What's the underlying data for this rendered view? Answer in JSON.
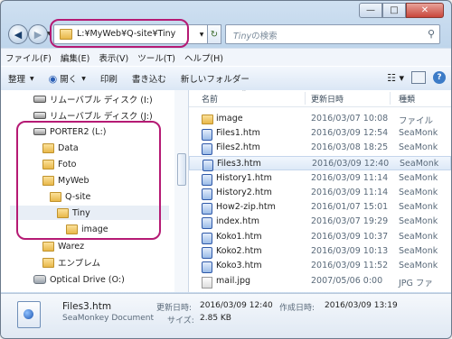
{
  "address": {
    "path": "L:¥MyWeb¥Q-site¥Tiny"
  },
  "search": {
    "prefix": "Tiny",
    "suffix": "の検索"
  },
  "menu": [
    "ファイル(F)",
    "編集(E)",
    "表示(V)",
    "ツール(T)",
    "ヘルプ(H)"
  ],
  "toolbar": {
    "organize": "整理",
    "open": "開く",
    "print": "印刷",
    "burn": "書き込む",
    "new_folder": "新しいフォルダー"
  },
  "tree": [
    {
      "label": "リムーバブル ディスク (I:)",
      "icon": "drive-icon"
    },
    {
      "label": "リムーバブル ディスク (J:)",
      "icon": "drive-icon"
    },
    {
      "label": "PORTER2 (L:)",
      "icon": "drive-icon"
    },
    {
      "label": "Data",
      "icon": "folder-icon"
    },
    {
      "label": "Foto",
      "icon": "folder-icon"
    },
    {
      "label": "MyWeb",
      "icon": "folder-icon"
    },
    {
      "label": "Q-site",
      "icon": "folder-icon"
    },
    {
      "label": "Tiny",
      "icon": "folder-icon"
    },
    {
      "label": "image",
      "icon": "folder-icon"
    },
    {
      "label": "Warez",
      "icon": "folder-icon"
    },
    {
      "label": "エンブレム",
      "icon": "folder-icon"
    },
    {
      "label": "Optical Drive (O:)",
      "icon": "disk-icon"
    }
  ],
  "columns": {
    "name": "名前",
    "date": "更新日時",
    "type": "種類"
  },
  "files": [
    {
      "name": "image",
      "date": "2016/03/07 10:08",
      "type": "ファイル",
      "icon": "folder-icon"
    },
    {
      "name": "Files1.htm",
      "date": "2016/03/09 12:54",
      "type": "SeaMonk",
      "icon": "htm-icon"
    },
    {
      "name": "Files2.htm",
      "date": "2016/03/08 18:25",
      "type": "SeaMonk",
      "icon": "htm-icon"
    },
    {
      "name": "Files3.htm",
      "date": "2016/03/09 12:40",
      "type": "SeaMonk",
      "icon": "htm-icon"
    },
    {
      "name": "History1.htm",
      "date": "2016/03/09 11:14",
      "type": "SeaMonk",
      "icon": "htm-icon"
    },
    {
      "name": "History2.htm",
      "date": "2016/03/09 11:14",
      "type": "SeaMonk",
      "icon": "htm-icon"
    },
    {
      "name": "How2-zip.htm",
      "date": "2016/01/07 15:01",
      "type": "SeaMonk",
      "icon": "htm-icon"
    },
    {
      "name": "index.htm",
      "date": "2016/03/07 19:29",
      "type": "SeaMonk",
      "icon": "htm-icon"
    },
    {
      "name": "Koko1.htm",
      "date": "2016/03/09 10:37",
      "type": "SeaMonk",
      "icon": "htm-icon"
    },
    {
      "name": "Koko2.htm",
      "date": "2016/03/09 10:13",
      "type": "SeaMonk",
      "icon": "htm-icon"
    },
    {
      "name": "Koko3.htm",
      "date": "2016/03/09 11:52",
      "type": "SeaMonk",
      "icon": "htm-icon"
    },
    {
      "name": "mail.jpg",
      "date": "2007/05/06 0:00",
      "type": "JPG ファ",
      "icon": "jpg-icon"
    }
  ],
  "details": {
    "name": "Files3.htm",
    "type": "SeaMonkey Document",
    "modified_label": "更新日時:",
    "modified": "2016/03/09 12:40",
    "created_label": "作成日時:",
    "created": "2016/03/09 13:19",
    "size_label": "サイズ:",
    "size": "2.85 KB"
  }
}
